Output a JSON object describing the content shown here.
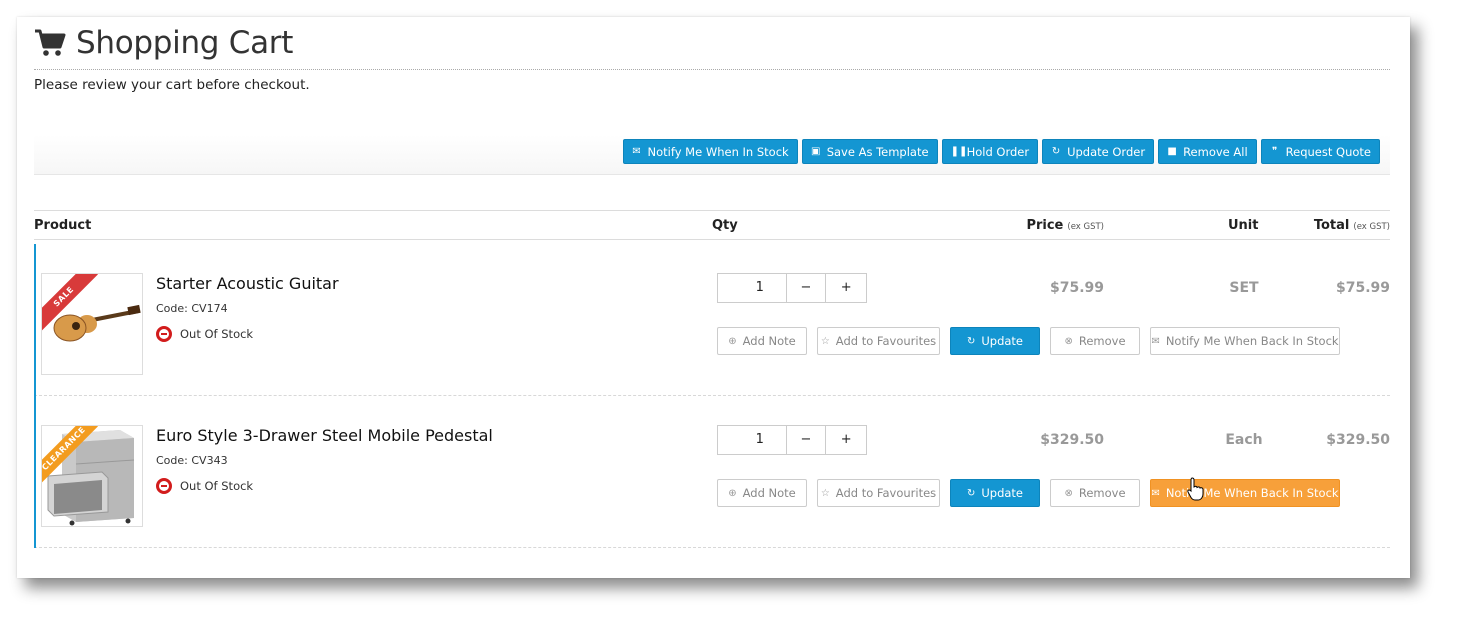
{
  "page": {
    "title": "Shopping Cart",
    "subtitle": "Please review your cart before checkout."
  },
  "toolbar": {
    "buttons": [
      {
        "label": "Notify Me When In Stock",
        "icon": "envelope-icon"
      },
      {
        "label": "Save As Template",
        "icon": "save-icon"
      },
      {
        "label": "Hold Order",
        "icon": "pause-icon"
      },
      {
        "label": "Update Order",
        "icon": "refresh-icon"
      },
      {
        "label": "Remove All",
        "icon": "trash-icon"
      },
      {
        "label": "Request Quote",
        "icon": "quote-icon"
      }
    ]
  },
  "table": {
    "headers": {
      "product": "Product",
      "qty": "Qty",
      "price": "Price",
      "price_note": "(ex GST)",
      "unit": "Unit",
      "total": "Total",
      "total_note": "(ex GST)"
    }
  },
  "items": [
    {
      "name": "Starter Acoustic Guitar",
      "code": "Code: CV174",
      "ribbon": "SALE",
      "stock": "Out Of Stock",
      "qty": "1",
      "minus": "−",
      "plus": "+",
      "price": "$75.99",
      "unit": "SET",
      "total": "$75.99",
      "actions": {
        "add_note": "Add Note",
        "favourites": "Add to Favourites",
        "update": "Update",
        "remove": "Remove",
        "notify": "Notify Me When Back In Stock"
      }
    },
    {
      "name": "Euro Style 3-Drawer Steel Mobile Pedestal",
      "code": "Code: CV343",
      "ribbon": "CLEARANCE",
      "stock": "Out Of Stock",
      "qty": "1",
      "minus": "−",
      "plus": "+",
      "price": "$329.50",
      "unit": "Each",
      "total": "$329.50",
      "actions": {
        "add_note": "Add Note",
        "favourites": "Add to Favourites",
        "update": "Update",
        "remove": "Remove",
        "notify": "Notify Me When Back In Stock"
      }
    }
  ],
  "colors": {
    "primary": "#1496d2",
    "warning": "#f7a03a",
    "danger": "#d21c1c"
  }
}
